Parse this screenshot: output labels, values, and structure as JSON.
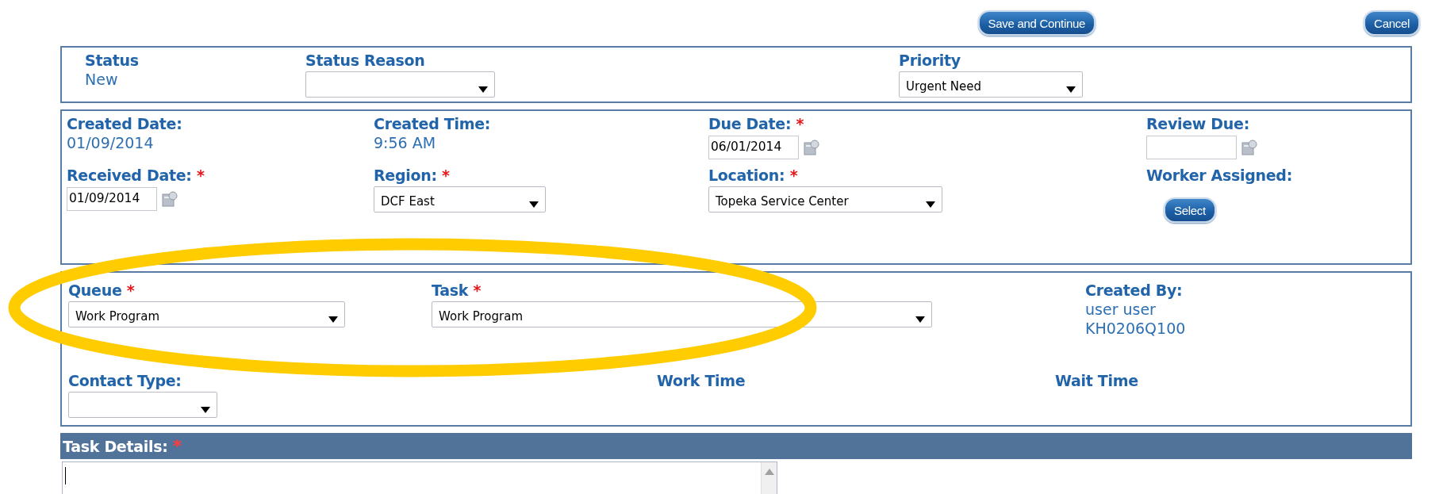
{
  "actions": [
    {
      "label": "Save and Continue"
    },
    {
      "label": "Cancel"
    }
  ],
  "panels": [
    {
      "rows": [
        [
          {
            "kind": "text",
            "label": "Status",
            "values": [
              "New"
            ]
          },
          {
            "kind": "select",
            "label": "Status Reason"
          },
          {
            "kind": "select",
            "label": "Priority",
            "value": "Urgent Need"
          }
        ]
      ]
    },
    {
      "rows": [
        [
          {
            "kind": "text",
            "label": "Created Date:",
            "values": [
              "01/09/2014"
            ]
          },
          {
            "kind": "text",
            "label": "Created Time:",
            "values": [
              "9:56 AM"
            ]
          },
          {
            "kind": "date",
            "label": "Due Date:",
            "required_mark": "*",
            "value": "06/01/2014"
          },
          {
            "kind": "date",
            "label": "Review Due:"
          }
        ],
        [
          {
            "kind": "date",
            "label": "Received Date:",
            "required_mark": "*",
            "value": "01/09/2014"
          },
          {
            "kind": "select",
            "label": "Region:",
            "required_mark": "*",
            "value": "DCF East"
          },
          {
            "kind": "select",
            "label": "Location:",
            "required_mark": "*",
            "value": "Topeka Service Center"
          },
          {
            "kind": "button",
            "label": "Worker Assigned:",
            "button": "Select"
          }
        ]
      ]
    },
    {
      "rows": [
        [
          {
            "kind": "select",
            "label": "Queue",
            "required_mark": "*",
            "value": "Work Program"
          },
          {
            "kind": "select",
            "label": "Task",
            "required_mark": "*",
            "value": "Work Program"
          },
          {
            "kind": "text",
            "label": "Created By:",
            "values": [
              "user user",
              "KH0206Q100"
            ]
          }
        ],
        [
          {
            "kind": "select",
            "label": "Contact Type:"
          },
          {
            "kind": "label",
            "label": "Work Time"
          },
          {
            "kind": "label",
            "label": "Wait Time"
          }
        ]
      ]
    }
  ],
  "task_details": {
    "label": "Task Details:",
    "required_mark": "*"
  }
}
